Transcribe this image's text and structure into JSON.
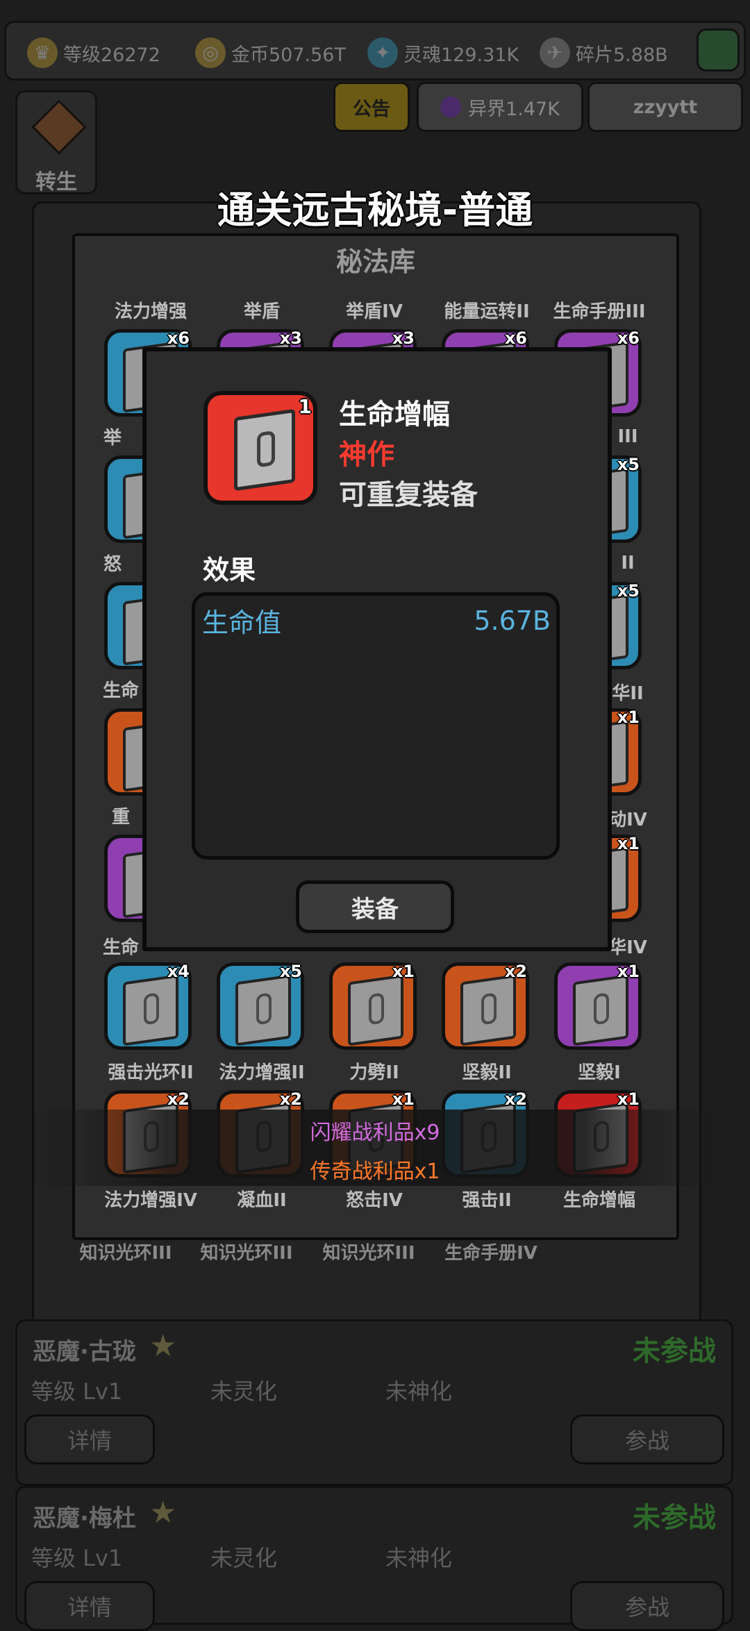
{
  "stats": {
    "level": "等级26272",
    "gold": "金币507.56T",
    "soul": "灵魂129.31K",
    "shards": "碎片5.88B"
  },
  "header": {
    "announce": "公告",
    "otherworld": "异界1.47K",
    "user": "zzyytt",
    "rebirth": "转生"
  },
  "banner_title": "通关远古秘境-普通",
  "library": {
    "title": "秘法库",
    "row0_labels": [
      "法力增强",
      "举盾",
      "举盾IV",
      "能量运转II",
      "生命手册III"
    ],
    "row0_counts": [
      "x6",
      "x3",
      "x3",
      "x6",
      "x6"
    ],
    "right_col": {
      "labels": [
        "III",
        "II",
        "华II",
        "动IV",
        "华IV"
      ],
      "counts": [
        "x5",
        "x5",
        "x1",
        "x1"
      ]
    },
    "left_col_labels": [
      "举",
      "怒",
      "生命",
      "重",
      "生命"
    ],
    "row5_labels": [
      "强击光环II",
      "法力增强II",
      "力劈II",
      "坚毅II",
      "坚毅I"
    ],
    "row5_counts": [
      "x4",
      "x5",
      "x1",
      "x2",
      "x1"
    ],
    "row6_labels": [
      "法力增强IV",
      "凝血II",
      "怒击IV",
      "强击II",
      "生命增幅"
    ],
    "row6_counts": [
      "x2",
      "x2",
      "x1",
      "x2",
      "x1"
    ],
    "row7_labels": [
      "知识光环III",
      "知识光环III",
      "知识光环III",
      "生命手册IV"
    ]
  },
  "dialog": {
    "item_name": "生命增幅",
    "rarity": "神作",
    "repeat": "可重复装备",
    "count": "1",
    "effect_heading": "效果",
    "effect_stat": "生命值",
    "effect_value": "5.67B",
    "equip_label": "装备",
    "rarity_color": "#ff3b30",
    "stat_color": "#5ab4e0"
  },
  "loot": {
    "line1": "闪耀战利品x9",
    "line2": "传奇战利品x1"
  },
  "heroes": [
    {
      "name": "恶魔·古珑",
      "status": "未参战",
      "level": "等级 Lv1",
      "spirit": "未灵化",
      "divine": "未神化",
      "detail": "详情",
      "fight": "参战"
    },
    {
      "name": "恶魔·梅杜",
      "status": "未参战",
      "level": "等级 Lv1",
      "spirit": "未灵化",
      "divine": "未神化",
      "detail": "详情",
      "fight": "参战"
    }
  ]
}
